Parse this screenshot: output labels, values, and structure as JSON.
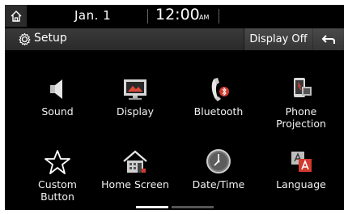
{
  "status": {
    "date": "Jan. 1",
    "time": "12:00",
    "ampm": "AM"
  },
  "titlebar": {
    "title": "Setup",
    "display_off_label": "Display Off"
  },
  "icons": {
    "home": "home-icon",
    "setup": "gear-icon",
    "back": "back-arrow-icon"
  },
  "menu": {
    "items": [
      {
        "label": "Sound",
        "icon": "speaker-icon"
      },
      {
        "label": "Display",
        "icon": "display-icon"
      },
      {
        "label": "Bluetooth",
        "icon": "bluetooth-phone-icon"
      },
      {
        "label": "Phone\nProjection",
        "icon": "phone-projection-icon"
      },
      {
        "label": "Custom\nButton",
        "icon": "star-icon"
      },
      {
        "label": "Home Screen",
        "icon": "home-screen-icon"
      },
      {
        "label": "Date/Time",
        "icon": "clock-icon"
      },
      {
        "label": "Language",
        "icon": "language-icon"
      }
    ]
  },
  "pager": {
    "current_page": 1,
    "total_pages": 2
  }
}
